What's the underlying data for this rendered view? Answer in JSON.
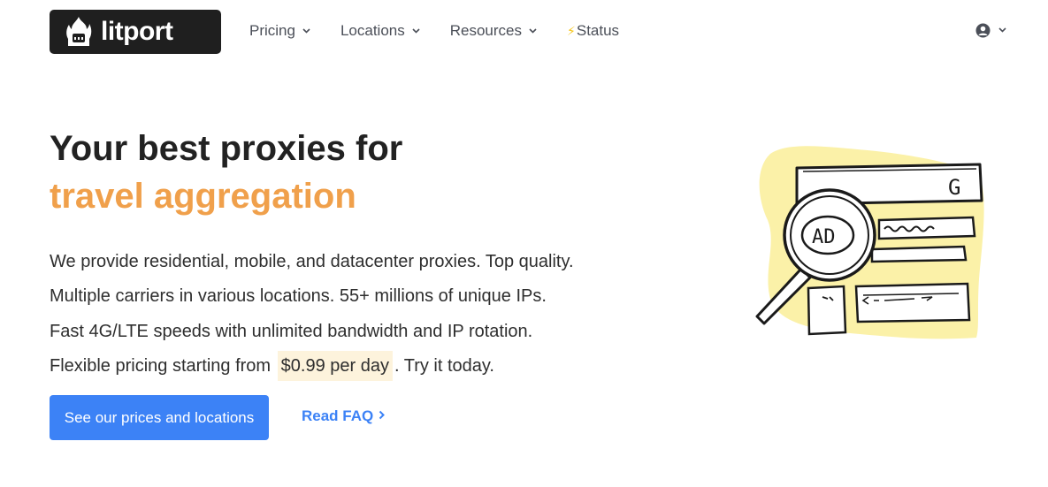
{
  "brand": {
    "name": "litport"
  },
  "nav": {
    "items": [
      {
        "label": "Pricing",
        "has_dropdown": true
      },
      {
        "label": "Locations",
        "has_dropdown": true
      },
      {
        "label": "Resources",
        "has_dropdown": true
      },
      {
        "label": "Status",
        "has_dropdown": false,
        "icon": "lightning-icon"
      }
    ]
  },
  "hero": {
    "title_line1": "Your best proxies for",
    "title_line2": "travel aggregation",
    "line1": "We provide residential, mobile, and datacenter proxies. Top quality.",
    "line2": "Multiple carriers in various locations. 55+ millions of unique IPs.",
    "line3": "Fast 4G/LTE speeds with unlimited bandwidth and IP rotation.",
    "line4_prefix": "Flexible pricing starting from ",
    "line4_price": "$0.99 per day",
    "line4_suffix": ". Try it today.",
    "cta_label": "See our prices and locations",
    "faq_label": "Read FAQ"
  },
  "illustration": {
    "search_letter": "G",
    "ad_label": "AD"
  },
  "colors": {
    "accent": "#f0a04b",
    "primary": "#3c82f6",
    "logo_bg": "#1f1f1f",
    "highlight": "#fdf3dc",
    "illustration_blob": "#fbf1a8"
  }
}
